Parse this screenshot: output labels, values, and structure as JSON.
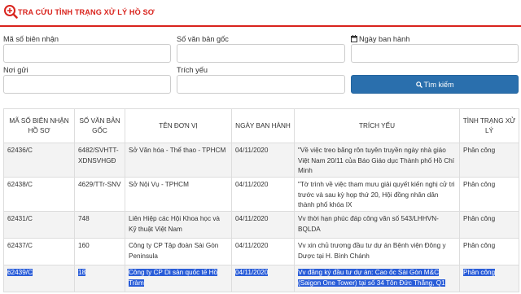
{
  "header": {
    "title": "TRA CỨU TÌNH TRẠNG XỬ LÝ HỒ SƠ"
  },
  "form": {
    "ma_so_label": "Mã số biên nhận",
    "so_van_ban_label": "Số văn bản gốc",
    "ngay_ban_hanh_label": "Ngày ban hành",
    "noi_gui_label": "Nơi gửi",
    "trich_yeu_label": "Trích yếu",
    "search_label": "Tìm kiếm"
  },
  "table": {
    "headers": [
      "MÃ SỐ BIÊN NHẬN HỒ SƠ",
      "SỐ VĂN BẢN GỐC",
      "TÊN ĐƠN VỊ",
      "NGÀY BAN HÀNH",
      "TRÍCH YẾU",
      "TÌNH TRẠNG XỬ LÝ"
    ],
    "rows": [
      {
        "ma": "62436/C",
        "so": "6482/SVHTT-XDNSVHGĐ",
        "don_vi": "Sở Văn hóa - Thể thao - TPHCM",
        "ngay": "04/11/2020",
        "trich_yeu": "\"Về việc treo băng rôn tuyên truyền ngày nhà giáo Việt Nam 20/11 của Báo Giáo dục Thành phố Hồ Chí Minh",
        "tinh_trang": "Phân công"
      },
      {
        "ma": "62438/C",
        "so": "4629/TTr-SNV",
        "don_vi": "Sở Nội Vụ - TPHCM",
        "ngay": "04/11/2020",
        "trich_yeu": "\"Tờ trình về việc tham mưu giải quyết kiến nghị cử tri trước và sau kỳ họp thứ 20, Hội đồng nhân dân thành phố khóa IX",
        "tinh_trang": "Phân công"
      },
      {
        "ma": "62431/C",
        "so": "748",
        "don_vi": "Liên Hiệp các Hội Khoa học và Kỹ thuật Việt Nam",
        "ngay": "04/11/2020",
        "trich_yeu": "Vv thời hạn phúc đáp công văn số 543/LHHVN-BQLDA",
        "tinh_trang": "Phân công"
      },
      {
        "ma": "62437/C",
        "so": "160",
        "don_vi": "Công ty CP Tập đoàn Sài Gòn Peninsula",
        "ngay": "04/11/2020",
        "trich_yeu": "Vv xin chủ trương đầu tư dự án Bệnh viện Đông y Dược tại H. Bình Chánh",
        "tinh_trang": "Phân công"
      },
      {
        "ma": "62439/C",
        "so": "18",
        "don_vi": "Công ty CP Di sản quốc tế Hồ Tràm",
        "ngay": "04/11/2020",
        "trich_yeu": "Vv đăng ký đầu tư dự án: Cao ốc Sài Gòn M&C (Saigon One Tower) tại số 34 Tôn Đức Thắng, Q1",
        "tinh_trang": "Phân công"
      }
    ]
  },
  "colors": {
    "brand_red": "#d9231d",
    "button_blue": "#2a6fad",
    "selection": "#2a5dd8"
  }
}
